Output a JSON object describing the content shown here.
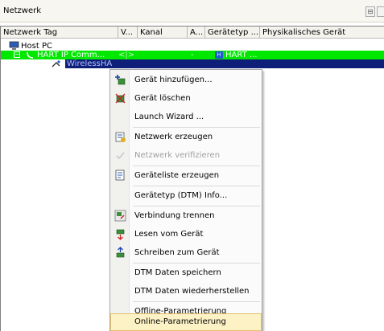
{
  "window": {
    "title": "Netzwerk"
  },
  "table": {
    "columns": [
      "Netzwerk Tag",
      "V...",
      "Kanal",
      "A...",
      "Gerätetyp ...",
      "Physikalisches Gerät"
    ],
    "rows": [
      {
        "tag": "Host PC"
      },
      {
        "tag": "HART IP Comm...",
        "channel_marker": "<|>",
        "dash": "-",
        "device_type": "HART ..."
      },
      {
        "tag": "WirelessHA"
      }
    ]
  },
  "context_menu": {
    "items": [
      {
        "label": "Gerät hinzufügen...",
        "icon": "add-device-icon",
        "enabled": true
      },
      {
        "label": "Gerät löschen",
        "icon": "delete-device-icon",
        "enabled": true
      },
      {
        "label": "Launch Wizard ...",
        "icon": "",
        "enabled": true
      },
      {
        "label": "Netzwerk erzeugen",
        "icon": "create-network-icon",
        "enabled": true
      },
      {
        "label": "Netzwerk verifizieren",
        "icon": "verify-network-icon",
        "enabled": false
      },
      {
        "label": "Geräteliste erzeugen",
        "icon": "device-list-icon",
        "enabled": true
      },
      {
        "label": "Gerätetyp (DTM) Info...",
        "icon": "",
        "enabled": true
      },
      {
        "label": "Verbindung trennen",
        "icon": "disconnect-icon",
        "enabled": true
      },
      {
        "label": "Lesen vom Gerät",
        "icon": "read-from-device-icon",
        "enabled": true
      },
      {
        "label": "Schreiben zum Gerät",
        "icon": "write-to-device-icon",
        "enabled": true
      },
      {
        "label": "DTM Daten speichern",
        "icon": "",
        "enabled": true
      },
      {
        "label": "DTM Daten wiederherstellen",
        "icon": "",
        "enabled": true
      },
      {
        "label": "Offline-Parametrierung",
        "icon": "",
        "enabled": true
      },
      {
        "label": "Online-Parametrierung",
        "icon": "",
        "enabled": true,
        "highlighted": true
      }
    ]
  },
  "colors": {
    "hart_row": "#00e800",
    "selection": "#0e1f7a",
    "menu_highlight": "#fdf2c5"
  }
}
